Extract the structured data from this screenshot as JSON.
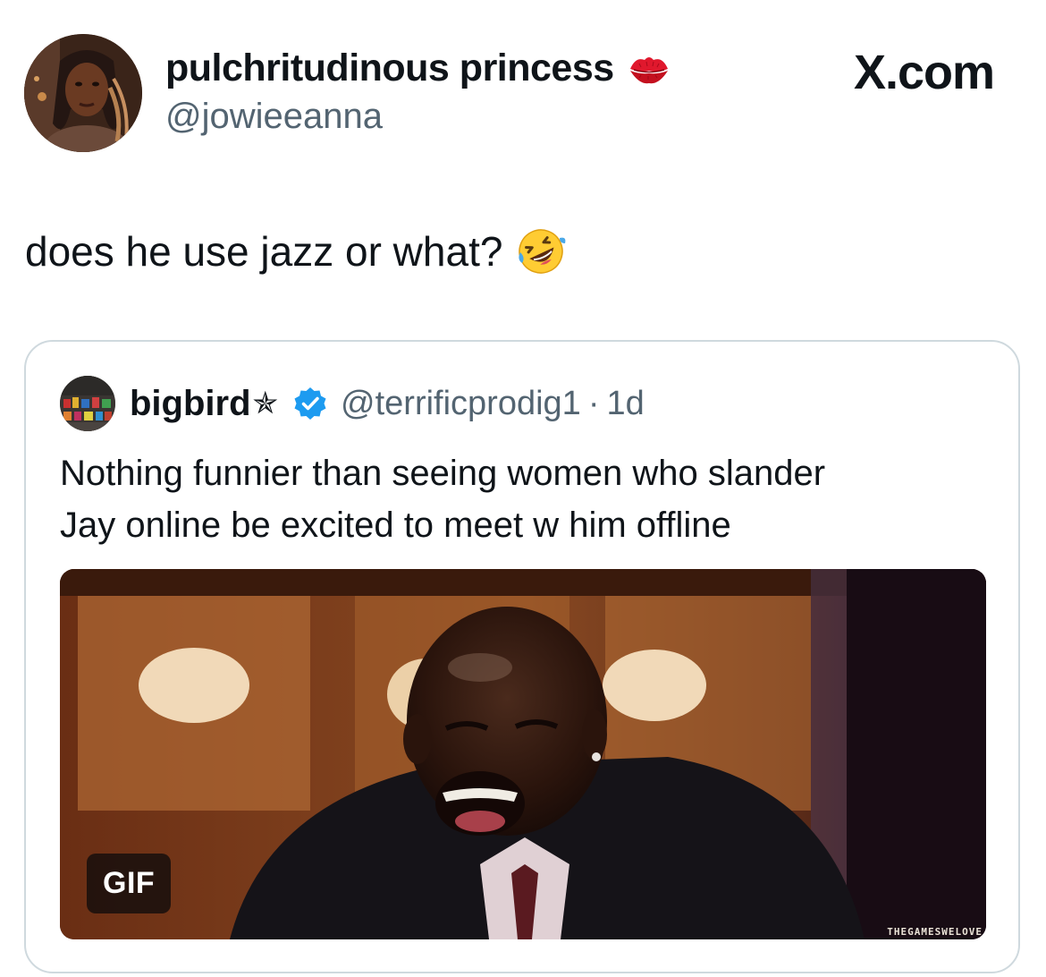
{
  "tweet": {
    "author_name": "pulchritudinous princess",
    "author_handle": "@jowieeanna",
    "name_emoji": "kiss-mark-icon",
    "text": "does he use jazz or what?",
    "text_emoji": "rolling-on-floor-laughing-icon"
  },
  "site": {
    "label": "X.com"
  },
  "quoted_tweet": {
    "author_name": "bigbird",
    "name_suffix": "✯",
    "verified_icon": "verified-badge-icon",
    "author_handle": "@terrificprodig1",
    "separator": "·",
    "time": "1d",
    "text_lines": [
      "Nothing funnier than seeing women who slander",
      "Jay online be excited to meet w him offline"
    ],
    "media": {
      "badge": "GIF",
      "watermark": "THEGAMESWELOVE"
    }
  },
  "colors": {
    "text_primary": "#0f1419",
    "text_secondary": "#536471",
    "border": "#cfd9de",
    "verified": "#1d9bf0",
    "kiss": "#e0182d"
  }
}
